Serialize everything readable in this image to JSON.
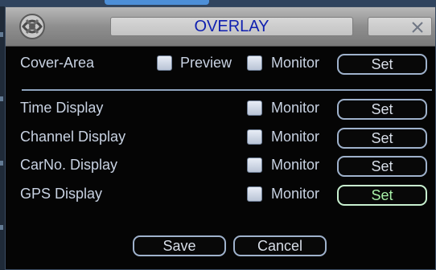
{
  "dialog": {
    "title": "OVERLAY"
  },
  "cover_area": {
    "label": "Cover-Area",
    "preview_label": "Preview",
    "monitor_label": "Monitor",
    "set_label": "Set"
  },
  "rows": [
    {
      "label": "Time Display",
      "monitor_label": "Monitor",
      "set_label": "Set"
    },
    {
      "label": "Channel Display",
      "monitor_label": "Monitor",
      "set_label": "Set"
    },
    {
      "label": "CarNo. Display",
      "monitor_label": "Monitor",
      "set_label": "Set"
    },
    {
      "label": "GPS Display",
      "monitor_label": "Monitor",
      "set_label": "Set"
    }
  ],
  "footer": {
    "save_label": "Save",
    "cancel_label": "Cancel"
  },
  "colors": {
    "title_text": "#0f1fb0",
    "label_text": "#c8d2e2",
    "focused_button_text": "#a8f0a8"
  },
  "icons": {
    "logo": "app-logo-icon",
    "close": "close-icon"
  }
}
